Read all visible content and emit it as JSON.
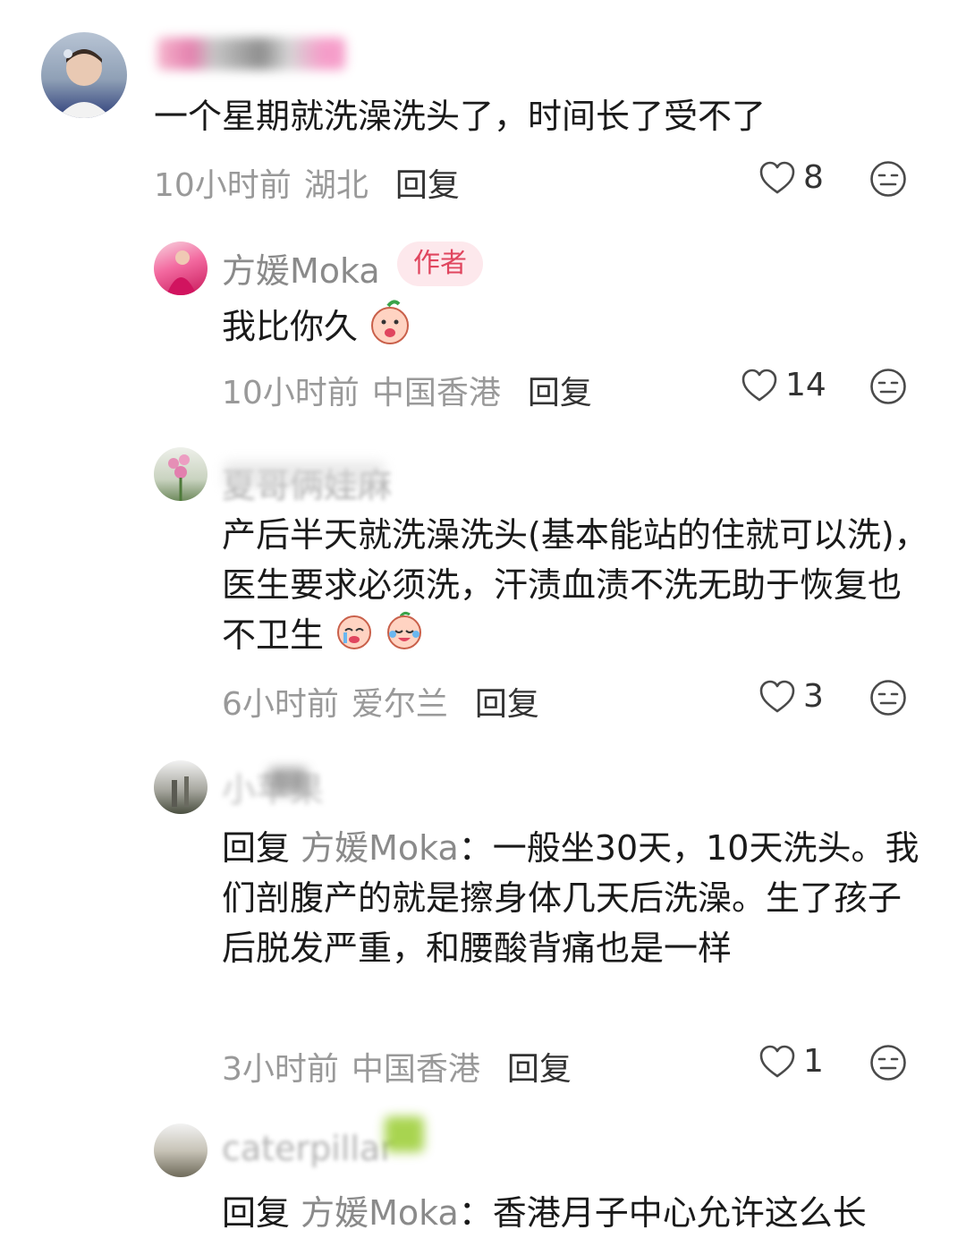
{
  "comments": [
    {
      "text": "一个星期就洗澡洗头了，时间长了受不了",
      "time": "10小时前",
      "location": "湖北",
      "reply_label": "回复",
      "likes": "8"
    },
    {
      "name": "方媛Moka",
      "badge": "作者",
      "text": "我比你久",
      "time": "10小时前",
      "location": "中国香港",
      "reply_label": "回复",
      "likes": "14"
    },
    {
      "name": "夏哥俩娃麻",
      "text": "产后半天就洗澡洗头(基本能站的住就可以洗)，医生要求必须洗，汗渍血渍不洗无助于恢复也不卫生",
      "time": "6小时前",
      "location": "爱尔兰",
      "reply_label": "回复",
      "likes": "3"
    },
    {
      "name": "小苹果",
      "reply_prefix": "回复",
      "reply_target": "方媛Moka",
      "text": "：一般坐30天，10天洗头。我们剖腹产的就是擦身体几天后洗澡。生了孩子后脱发严重，和腰酸背痛也是一样",
      "time": "3小时前",
      "location": "中国香港",
      "reply_label": "回复",
      "likes": "1"
    },
    {
      "name": "caterpillar",
      "reply_prefix": "回复",
      "reply_target": "方媛Moka",
      "text": "：香港月子中心允许这么长"
    }
  ],
  "icons": {
    "like": "heart-outline-icon",
    "dislike": "unhappy-face-icon"
  },
  "colors": {
    "badge_bg": "#fde8ec",
    "badge_text": "#e0455e"
  }
}
